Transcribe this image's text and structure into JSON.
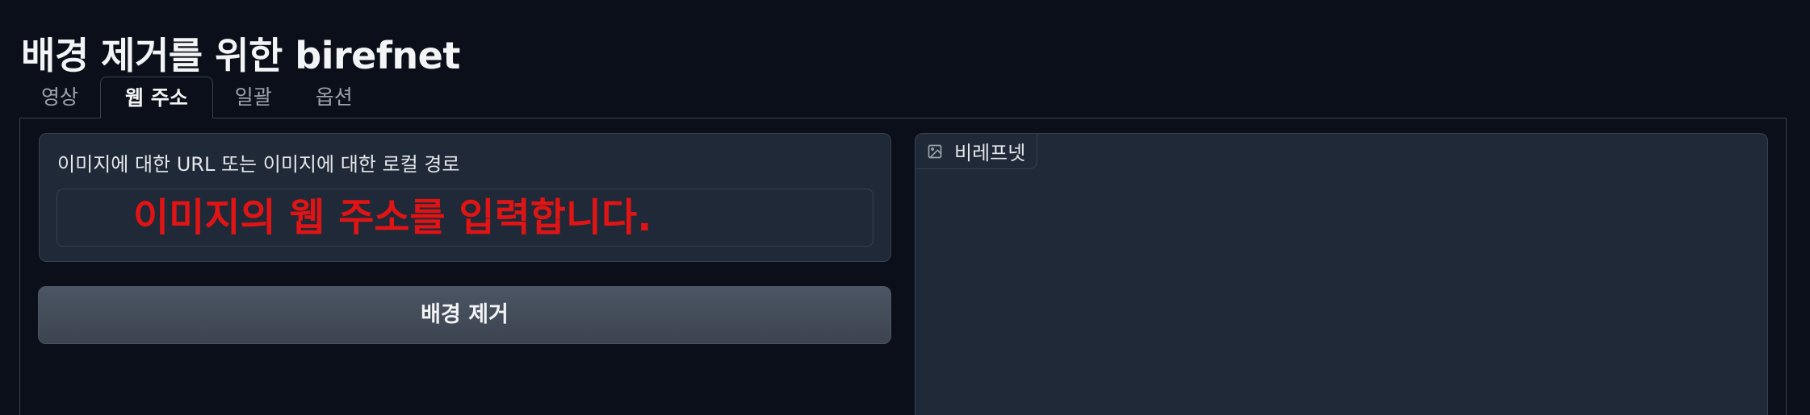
{
  "page": {
    "title": "배경 제거를 위한 birefnet"
  },
  "tabs": [
    {
      "label": "영상",
      "active": false
    },
    {
      "label": "웹 주소",
      "active": true
    },
    {
      "label": "일괄",
      "active": false
    },
    {
      "label": "옵션",
      "active": false
    }
  ],
  "url_input": {
    "label": "이미지에 대한 URL 또는 이미지에 대한 로컬 경로",
    "placeholder": "이미지의 웹 주소를 입력합니다.",
    "value": ""
  },
  "remove_button": {
    "label": "배경 제거"
  },
  "output_image": {
    "label": "비레프넷",
    "icon": "image-icon"
  },
  "colors": {
    "background": "#0b0f19",
    "panel": "#1f2937",
    "border": "#374151",
    "button": "#4b5563",
    "placeholder_red": "#e01414"
  }
}
